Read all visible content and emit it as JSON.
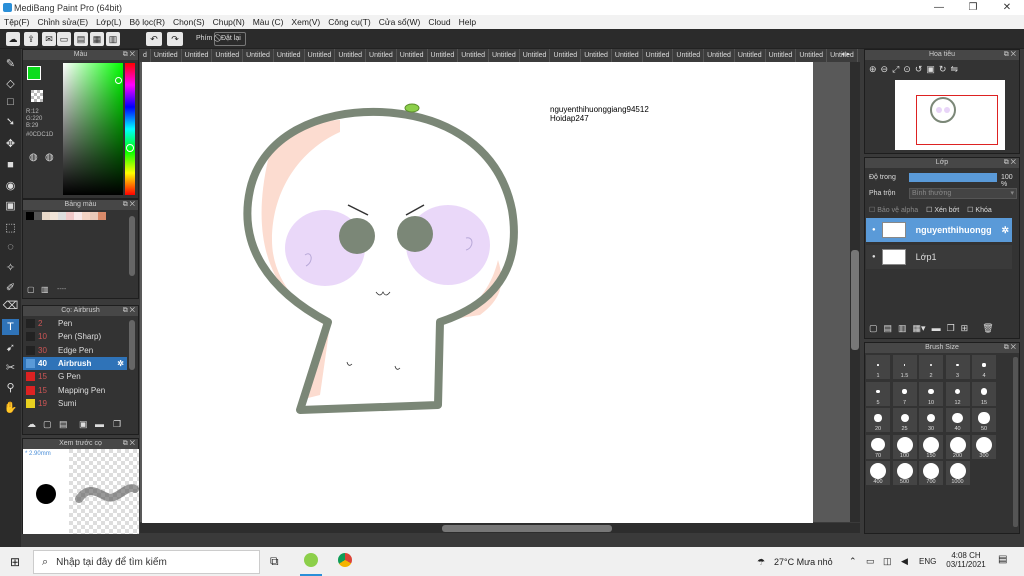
{
  "window": {
    "title": "MediBang Paint Pro (64bit)"
  },
  "menu": [
    "Tệp(F)",
    "Chỉnh sửa(E)",
    "Lớp(L)",
    "Bộ lọc(R)",
    "Chọn(S)",
    "Chụp(N)",
    "Màu (C)",
    "Xem(V)",
    "Công cụ(T)",
    "Cửa sổ(W)",
    "Cloud",
    "Help"
  ],
  "toolbar": {
    "phim": "Phím",
    "reset": "Đặt lại"
  },
  "tabs": {
    "first": "d",
    "items": [
      "Untitled",
      "Untitled",
      "Untitled",
      "Untitled",
      "Untitled",
      "Untitled",
      "Untitled",
      "Untitled",
      "Untitled",
      "Untitled",
      "Untitled",
      "Untitled",
      "Untitled",
      "Untitled",
      "Untitled",
      "Untitled",
      "Untitled",
      "Untitled",
      "Untitled",
      "Untitled",
      "Untitled",
      "Untitled",
      "Untitled",
      "Untitled",
      "Untitled",
      "Untitled"
    ]
  },
  "color_panel": {
    "title": "Màu",
    "r": "R:12",
    "g": "G:220",
    "b": "B:29",
    "hex": "#0CDC1D",
    "fg_color": "#0cdc1d"
  },
  "palette": {
    "title": "Bảng màu",
    "value": "----"
  },
  "brush_panel": {
    "title": "Cọ: Airbrush",
    "items": [
      {
        "size": "2",
        "name": "Pen",
        "color": "#222222",
        "active": false
      },
      {
        "size": "10",
        "name": "Pen (Sharp)",
        "color": "#222222",
        "active": false
      },
      {
        "size": "30",
        "name": "Edge Pen",
        "color": "#222222",
        "active": false
      },
      {
        "size": "40",
        "name": "Airbrush",
        "color": "#5a9ad8",
        "active": true
      },
      {
        "size": "15",
        "name": "G Pen",
        "color": "#d22",
        "active": false
      },
      {
        "size": "15",
        "name": "Mapping Pen",
        "color": "#d22",
        "active": false
      },
      {
        "size": "19",
        "name": "Sumi",
        "color": "#e8d020",
        "active": false
      }
    ]
  },
  "preview": {
    "title": "Xem trước cọ",
    "size": "2.90mm"
  },
  "navigator": {
    "title": "Hoa tiêu"
  },
  "layer_panel": {
    "title": "Lớp",
    "opacity_label": "Độ trong",
    "opacity_value": "100 %",
    "blend_label": "Pha trộn",
    "blend_value": "Bình thường",
    "protect_alpha": "Bảo vệ alpha",
    "clip": "Xén bớt",
    "lock": "Khóa",
    "layers": [
      {
        "name": "nguyenthihuongg",
        "active": true
      },
      {
        "name": "Lớp1",
        "active": false
      }
    ]
  },
  "brush_size": {
    "title": "Brush Size",
    "sizes": [
      "1",
      "1.5",
      "2",
      "3",
      "4",
      "5",
      "7",
      "10",
      "12",
      "15",
      "20",
      "25",
      "30",
      "40",
      "50",
      "70",
      "100",
      "150",
      "200",
      "300",
      "400",
      "500",
      "700",
      "1000"
    ]
  },
  "canvas": {
    "signature_line1": "nguyenthihuonggiang94512",
    "signature_line2": "Hoidap247"
  },
  "taskbar": {
    "search_placeholder": "Nhập tại đây để tìm kiếm",
    "weather": "27°C  Mưa nhỏ",
    "lang": "ENG",
    "time": "4:08 CH",
    "date": "03/11/2021"
  }
}
